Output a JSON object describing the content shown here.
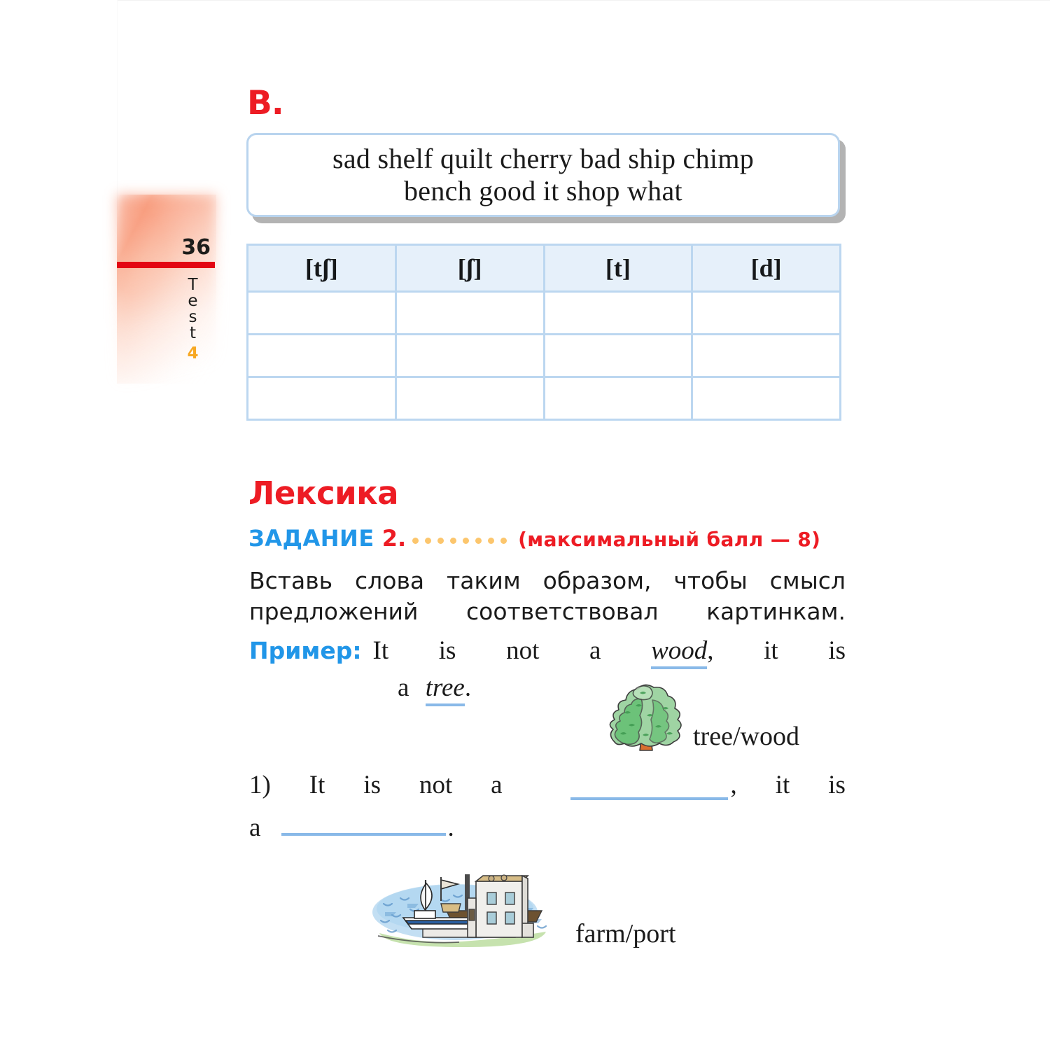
{
  "margin": {
    "page_number": "36",
    "test_label_letters": [
      "T",
      "e",
      "s",
      "t"
    ],
    "test_number": "4",
    "rule_color": "#e30613",
    "accent_color": "#f7a823"
  },
  "section": {
    "letter": "B.",
    "letter_color": "#ed1c24"
  },
  "word_bank": {
    "line1": "sad  shelf  quilt  cherry  bad  ship  chimp",
    "line2": "bench  good  it  shop  what",
    "border_color": "#b9d4ee"
  },
  "phonetics_table": {
    "headers": [
      "[tʃ]",
      "[ʃ]",
      "[t]",
      "[d]"
    ],
    "rows": [
      [
        "",
        "",
        "",
        ""
      ],
      [
        "",
        "",
        "",
        ""
      ],
      [
        "",
        "",
        "",
        ""
      ]
    ],
    "header_bg": "#e6f0fa",
    "border_color": "#bcd7f0"
  },
  "lexika": {
    "title": "Лексика",
    "title_color": "#ed1c24",
    "task_label": "ЗАДАНИЕ",
    "task_label_color": "#2196e8",
    "task_number": "2.",
    "dot_count": 8,
    "dot_color": "#fcc66d",
    "max_score_text": "(максимальный  балл — 8)"
  },
  "instruction": {
    "text": "Вставь слова таким образом, чтобы смысл предложений соответствовал картинкам."
  },
  "example": {
    "prefix": "Пример:",
    "prefix_color": "#2196e8",
    "parts": [
      "It",
      "is",
      "not",
      "a",
      "wood",
      ",",
      "it",
      "is"
    ],
    "word1": "wood",
    "line2_a": "a",
    "word2": "tree",
    "line2_end": ".",
    "underline_color": "#89b9e8"
  },
  "pictures": [
    {
      "name": "tree-illustration",
      "label": "tree/wood"
    },
    {
      "name": "port-illustration",
      "label": "farm/port"
    }
  ],
  "question1": {
    "number": "1)",
    "words": [
      "It",
      "is",
      "not",
      "a"
    ],
    "comma": ",",
    "tail": [
      "it",
      "is"
    ],
    "line2_lead": "a",
    "period": "."
  }
}
